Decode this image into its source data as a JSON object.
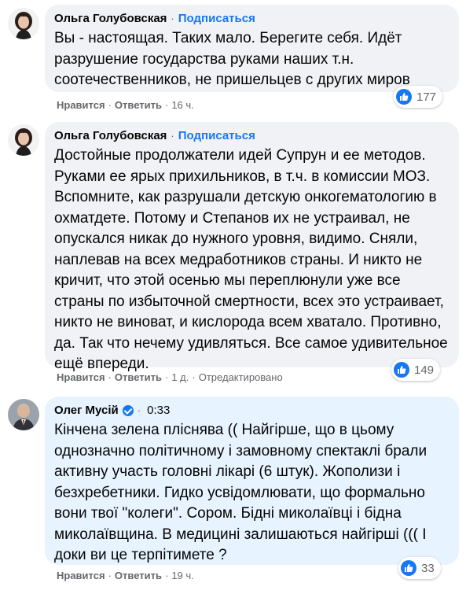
{
  "comments": [
    {
      "author": "Ольга Голубовская",
      "subscribe": "Подписаться",
      "text": "Вы - настоящая. Таких мало. Берегите себя. Идёт разрушение государства руками наших т.н. соотечественников, не пришельцев с других миров",
      "like": "Нравится",
      "reply": "Ответить",
      "time": "16 ч.",
      "reactions": "177",
      "avatar_icon": "woman-avatar"
    },
    {
      "author": "Ольга Голубовская",
      "subscribe": "Подписаться",
      "text": "Достойные продолжатели идей Супрун и ее методов. Руками ее ярых прихильников, в т.ч. в комиссии МОЗ. Вспомните, как разрушали детскую онкогематологию в охматдете. Потому и Степанов их не устраивал, не опускался никак до нужного уровня, видимо. Сняли, наплевав на всех медработников страны. И никто не кричит, что этой осенью мы переплюнули уже все страны по избыточной смертности, всех это устраивает, никто не виноват, и кислорода всем хватало. Противно, да. Так что нечему удивляться. Все самое удивительное ещё впереди.",
      "like": "Нравится",
      "reply": "Ответить",
      "time": "1 д.",
      "edited": "Отредактировано",
      "reactions": "149",
      "avatar_icon": "woman-avatar"
    },
    {
      "author": "Олег Мусій",
      "time_inline": "0:33",
      "text": "Кінчена зелена пліснява (( Найгірше, що в цьому однозначно політичному і замовному спектаклі брали активну участь головні лікарі (6 штук). Жополизи і безхребетники. Гидко усвідомлювати, що формально вони твої \"колеги\". Сором. Бідні миколаївці і бідна миколаївщина. В медицині залишаються найгірші ((( І доки ви це терпітимете ?",
      "like": "Нравится",
      "reply": "Ответить",
      "time": "19 ч.",
      "reactions": "33",
      "avatar_icon": "man-avatar",
      "verified_icon": "verified-badge-icon"
    }
  ],
  "colors": {
    "bubble": "#f0f2f5",
    "bubble_live": "#e7f3ff",
    "link": "#1877f2",
    "meta": "#65676b"
  }
}
